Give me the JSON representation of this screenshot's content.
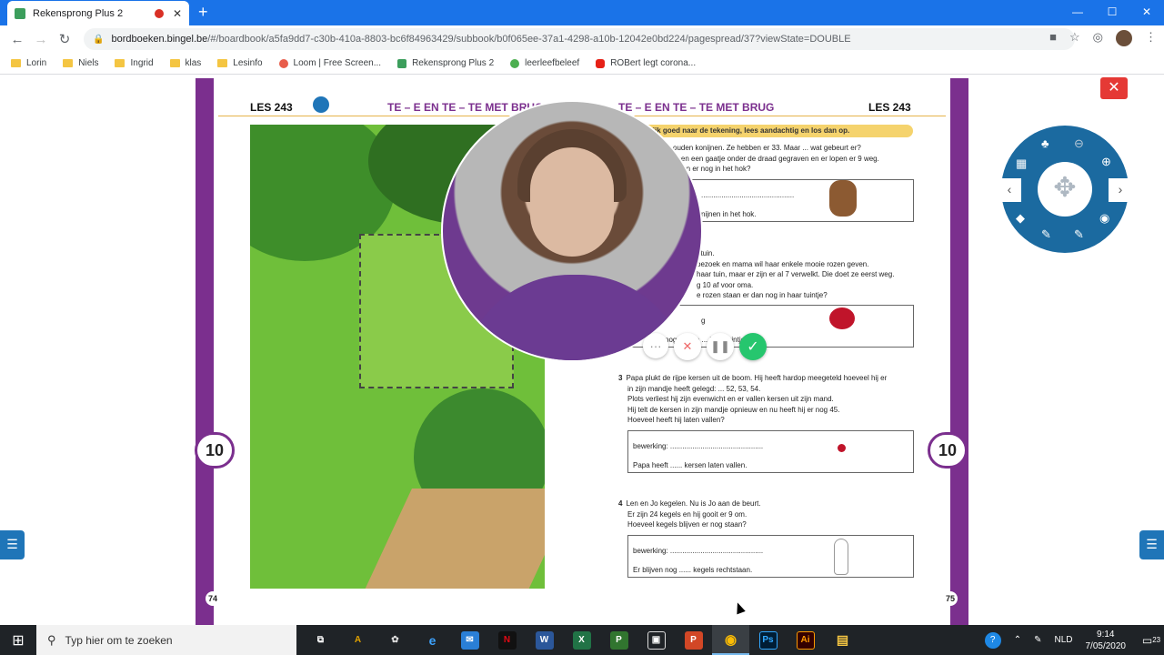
{
  "browser": {
    "tab_title": "Rekensprong Plus 2",
    "new_tab": "+",
    "close_tab": "✕",
    "window_controls": [
      "—",
      "☐",
      "✕"
    ],
    "url_host": "bordboeken.bingel.be",
    "url_path": "/#/boardbook/a5fa9dd7-c30b-410a-8803-bc6f84963429/subbook/b0f065ee-37a1-4298-a10b-12042e0bd224/pagespread/37?viewState=DOUBLE",
    "bookmarks": [
      "Lorin",
      "Niels",
      "Ingrid",
      "klas",
      "Lesinfo",
      "Loom | Free Screen...",
      "Rekensprong Plus 2",
      "leerleefbeleef",
      "ROBert legt corona..."
    ]
  },
  "book": {
    "left_les": "LES 243",
    "left_title": "TE – E EN TE – TE MET BRUG",
    "right_title": "TE – E EN TE – TE MET BRUG",
    "right_les": "LES 243",
    "tab_number": "10",
    "page_left": "74",
    "page_right": "75",
    "banner": "Kijk goed naar de tekening, lees aandachtig en los dan op.",
    "exercises": [
      {
        "num": "1",
        "lines": [
          "ouden konijnen. Ze hebben er 33. Maar ... wat gebeurt er?",
          "bben een gaatje onder de draad gegraven en er lopen er 9 weg.",
          "zitten er nog in het hok?"
        ],
        "work": "..............................................",
        "answer": "nijnen in het hok."
      },
      {
        "num": "2",
        "lines": [
          "ntuin.",
          "bezoek en mama wil haar enkele mooie rozen geven.",
          "haar tuin, maar er zijn er al 7 verwelkt. Die doet ze eerst weg.",
          "g 10 af voor oma.",
          "e rozen staan er dan nog in haar tuintje?"
        ],
        "work": "g",
        "answer": "nog ...... ro ... in ... tuintje."
      },
      {
        "num": "3",
        "lines": [
          "Papa plukt de rijpe kersen uit de boom. Hij heeft hardop meegeteld hoeveel hij er",
          "in zijn mandje heeft gelegd: ... 52, 53, 54.",
          "Plots verliest hij zijn evenwicht en er vallen kersen uit zijn mand.",
          "Hij telt de kersen in zijn mandje opnieuw en nu heeft hij er nog 45.",
          "Hoeveel heeft hij laten vallen?"
        ],
        "work": "bewerking: ..............................................",
        "answer": "Papa heeft ...... kersen laten vallen."
      },
      {
        "num": "4",
        "lines": [
          "Len en Jo kegelen. Nu is Jo aan de beurt.",
          "Er zijn 24 kegels en hij gooit er 9 om.",
          "Hoeveel kegels blijven er nog staan?"
        ],
        "work": "bewerking: ..............................................",
        "answer": "Er blijven nog ...... kegels rechtstaan."
      }
    ]
  },
  "recorder": {
    "more": "···",
    "cancel": "✕",
    "pause": "❚❚",
    "confirm": "✓"
  },
  "widget": {
    "close": "✕",
    "move": "✥",
    "prev": "‹",
    "next": "›",
    "menu": "☰"
  },
  "taskbar": {
    "start": "⊞",
    "search_placeholder": "Typ hier om te zoeken",
    "apps": [
      {
        "name": "taskview",
        "label": "⧉",
        "color": "#1f2327"
      },
      {
        "name": "acrobat",
        "label": "A",
        "color": "#e0a100"
      },
      {
        "name": "app-bird",
        "label": "✿",
        "color": "#555"
      },
      {
        "name": "edge",
        "label": "e",
        "color": "#1e88e5"
      },
      {
        "name": "mail",
        "label": "✉",
        "color": "#2a7fd6"
      },
      {
        "name": "netflix",
        "label": "N",
        "color": "#111"
      },
      {
        "name": "word",
        "label": "W",
        "color": "#2b579a"
      },
      {
        "name": "excel",
        "label": "X",
        "color": "#217346"
      },
      {
        "name": "project",
        "label": "P",
        "color": "#31752f"
      },
      {
        "name": "photos",
        "label": "▣",
        "color": "#333"
      },
      {
        "name": "powerpoint",
        "label": "P",
        "color": "#d24726"
      },
      {
        "name": "chrome",
        "label": "◉",
        "color": "#3a3f44"
      },
      {
        "name": "photoshop",
        "label": "Ps",
        "color": "#001d34"
      },
      {
        "name": "illustrator",
        "label": "Ai",
        "color": "#330000"
      },
      {
        "name": "explorer",
        "label": "▤",
        "color": "#f4c542"
      }
    ],
    "lang": "NLD",
    "time": "9:14",
    "date": "7/05/2020",
    "notifications": "23"
  }
}
